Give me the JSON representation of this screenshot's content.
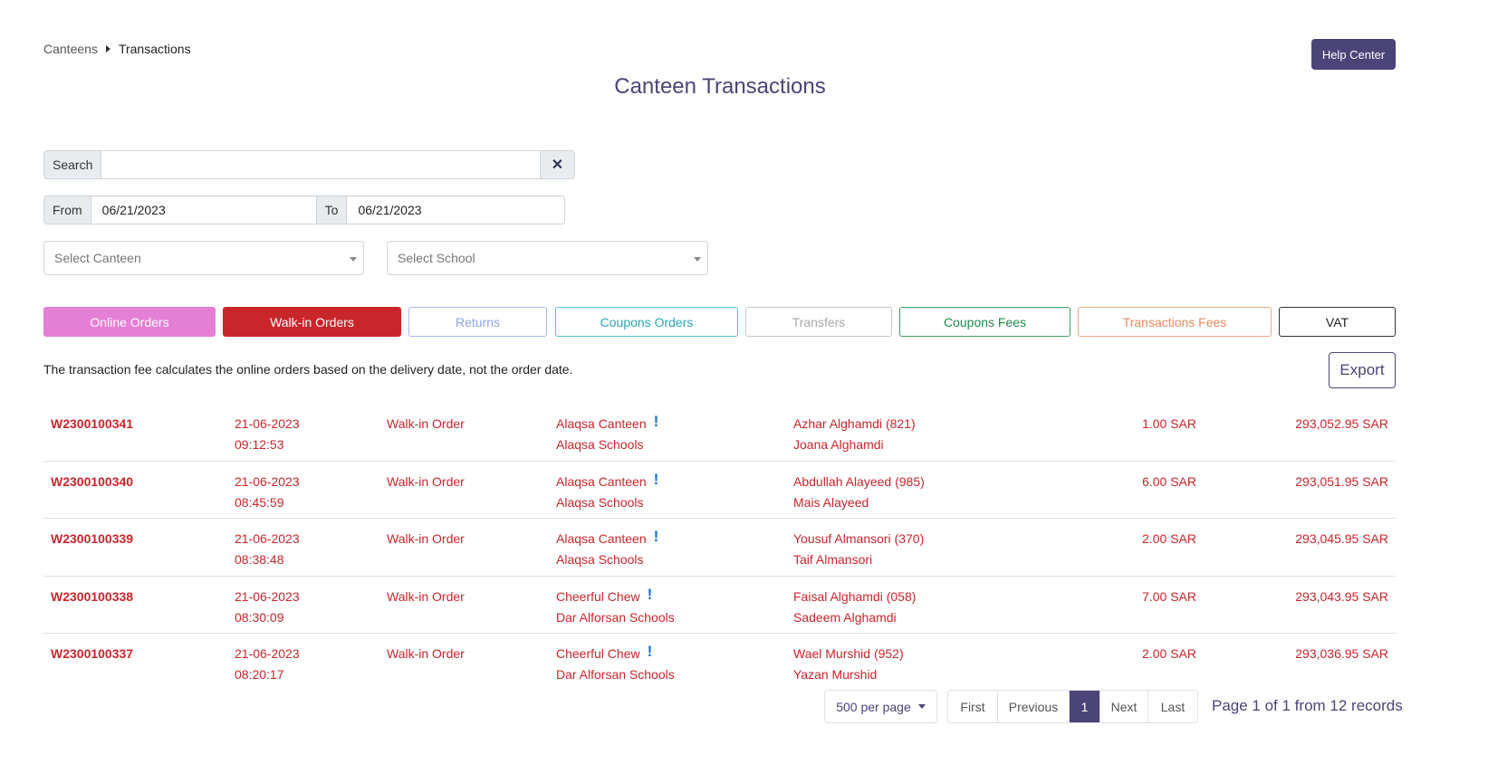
{
  "breadcrumb": {
    "root": "Canteens",
    "current": "Transactions"
  },
  "help_button": "Help Center",
  "title": "Canteen Transactions",
  "search": {
    "label": "Search",
    "value": "",
    "clear_icon": "close-icon"
  },
  "date_range": {
    "from_label": "From",
    "from_value": "06/21/2023",
    "to_label": "To",
    "to_value": "06/21/2023"
  },
  "selects": {
    "canteen_placeholder": "Select Canteen",
    "school_placeholder": "Select School"
  },
  "filters": {
    "online_orders": "Online Orders",
    "walkin_orders": "Walk-in Orders",
    "returns": "Returns",
    "coupons_orders": "Coupons Orders",
    "transfers": "Transfers",
    "coupons_fees": "Coupons Fees",
    "transactions_fees": "Transactions Fees",
    "vat": "VAT"
  },
  "note": "The transaction fee calculates the online orders based on the delivery date, not the order date.",
  "export_button": "Export",
  "transactions": [
    {
      "id": "W2300100341",
      "date": "21-06-2023",
      "time": "09:12:53",
      "type": "Walk-in Order",
      "canteen": "Alaqsa Canteen",
      "school": "Alaqsa Schools",
      "student": "Azhar Alghamdi (821)",
      "parent": "Joana Alghamdi",
      "amount": "1.00 SAR",
      "balance": "293,052.95 SAR"
    },
    {
      "id": "W2300100340",
      "date": "21-06-2023",
      "time": "08:45:59",
      "type": "Walk-in Order",
      "canteen": "Alaqsa Canteen",
      "school": "Alaqsa Schools",
      "student": "Abdullah Alayeed (985)",
      "parent": "Mais Alayeed",
      "amount": "6.00 SAR",
      "balance": "293,051.95 SAR"
    },
    {
      "id": "W2300100339",
      "date": "21-06-2023",
      "time": "08:38:48",
      "type": "Walk-in Order",
      "canteen": "Alaqsa Canteen",
      "school": "Alaqsa Schools",
      "student": "Yousuf Almansori (370)",
      "parent": "Taif Almansori",
      "amount": "2.00 SAR",
      "balance": "293,045.95 SAR"
    },
    {
      "id": "W2300100338",
      "date": "21-06-2023",
      "time": "08:30:09",
      "type": "Walk-in Order",
      "canteen": "Cheerful Chew",
      "school": "Dar Alforsan Schools",
      "student": "Faisal Alghamdi (058)",
      "parent": "Sadeem Alghamdi",
      "amount": "7.00 SAR",
      "balance": "293,043.95 SAR"
    },
    {
      "id": "W2300100337",
      "date": "21-06-2023",
      "time": "08:20:17",
      "type": "Walk-in Order",
      "canteen": "Cheerful Chew",
      "school": "Dar Alforsan Schools",
      "student": "Wael Murshid (952)",
      "parent": "Yazan Murshid",
      "amount": "2.00 SAR",
      "balance": "293,036.95 SAR"
    }
  ],
  "info_glyph": "!",
  "pagination": {
    "per_page": "500 per page",
    "first": "First",
    "previous": "Previous",
    "current": "1",
    "next": "Next",
    "last": "Last",
    "info": "Page 1 of 1 from 12 records"
  },
  "colors": {
    "brand": "#4b4478",
    "walkin_red": "#c9262c",
    "online_pink": "#e57fd5",
    "info_blue": "#1a6fd6"
  }
}
